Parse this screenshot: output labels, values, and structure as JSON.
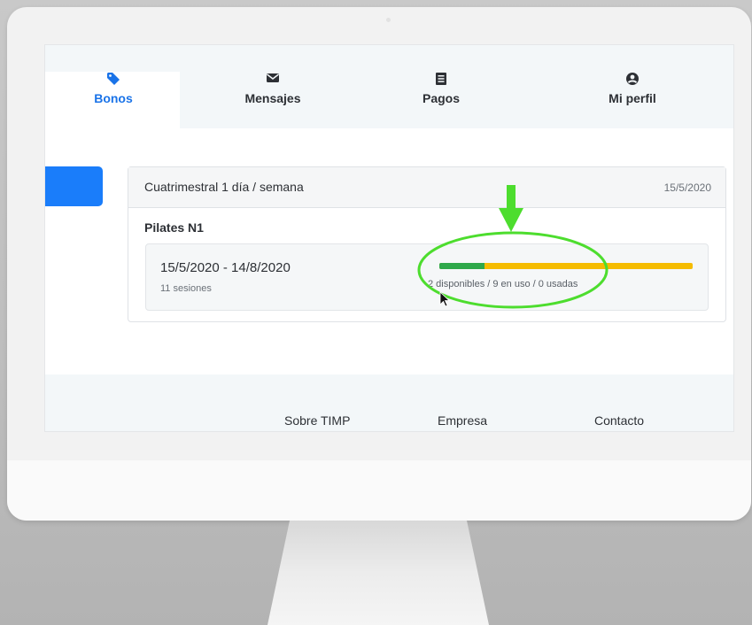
{
  "nav": {
    "tabs": [
      {
        "label": "Bonos",
        "icon": "tag-icon",
        "active": true
      },
      {
        "label": "Mensajes",
        "icon": "envelope-icon",
        "active": false
      },
      {
        "label": "Pagos",
        "icon": "receipt-icon",
        "active": false
      },
      {
        "label": "Mi perfil",
        "icon": "user-circle-icon",
        "active": false
      }
    ]
  },
  "card": {
    "title": "Cuatrimestral 1 día / semana",
    "date": "15/5/2020",
    "subtitle": "Pilates N1",
    "period": {
      "range": "15/5/2020 - 14/8/2020",
      "sessions": "11 sesiones",
      "usage_text": "2 disponibles / 9 en uso / 0 usadas",
      "available_fraction": 0.18
    }
  },
  "footer": {
    "links": [
      "Sobre TIMP",
      "Empresa",
      "Contacto"
    ]
  },
  "colors": {
    "accent": "#1a73e8",
    "available": "#2ea84a",
    "in_use": "#f5bc00",
    "annotation": "#4ddd2e"
  }
}
